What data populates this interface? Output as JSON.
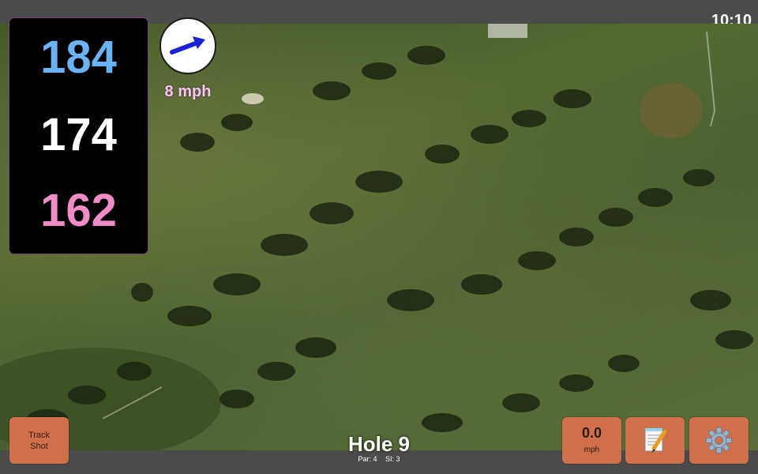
{
  "status_bar": {
    "time": "10:10"
  },
  "distances": {
    "back": "184",
    "middle": "174",
    "front": "162"
  },
  "wind": {
    "speed_label": "8 mph",
    "arrow_color": "#1a22d6"
  },
  "buttons": {
    "track_shot_label": "Track\nShot",
    "speed_value": "0.0",
    "speed_unit": "mph",
    "notes_icon": "notepad-pencil-icon",
    "settings_icon": "gear-icon"
  },
  "hole": {
    "title": "Hole 9",
    "par": "Par: 4",
    "si": "SI: 3"
  },
  "colors": {
    "back_distance": "#6ab4f5",
    "middle_distance": "#ffffff",
    "front_distance": "#f08cc6",
    "button_accent": "#d0704a"
  }
}
